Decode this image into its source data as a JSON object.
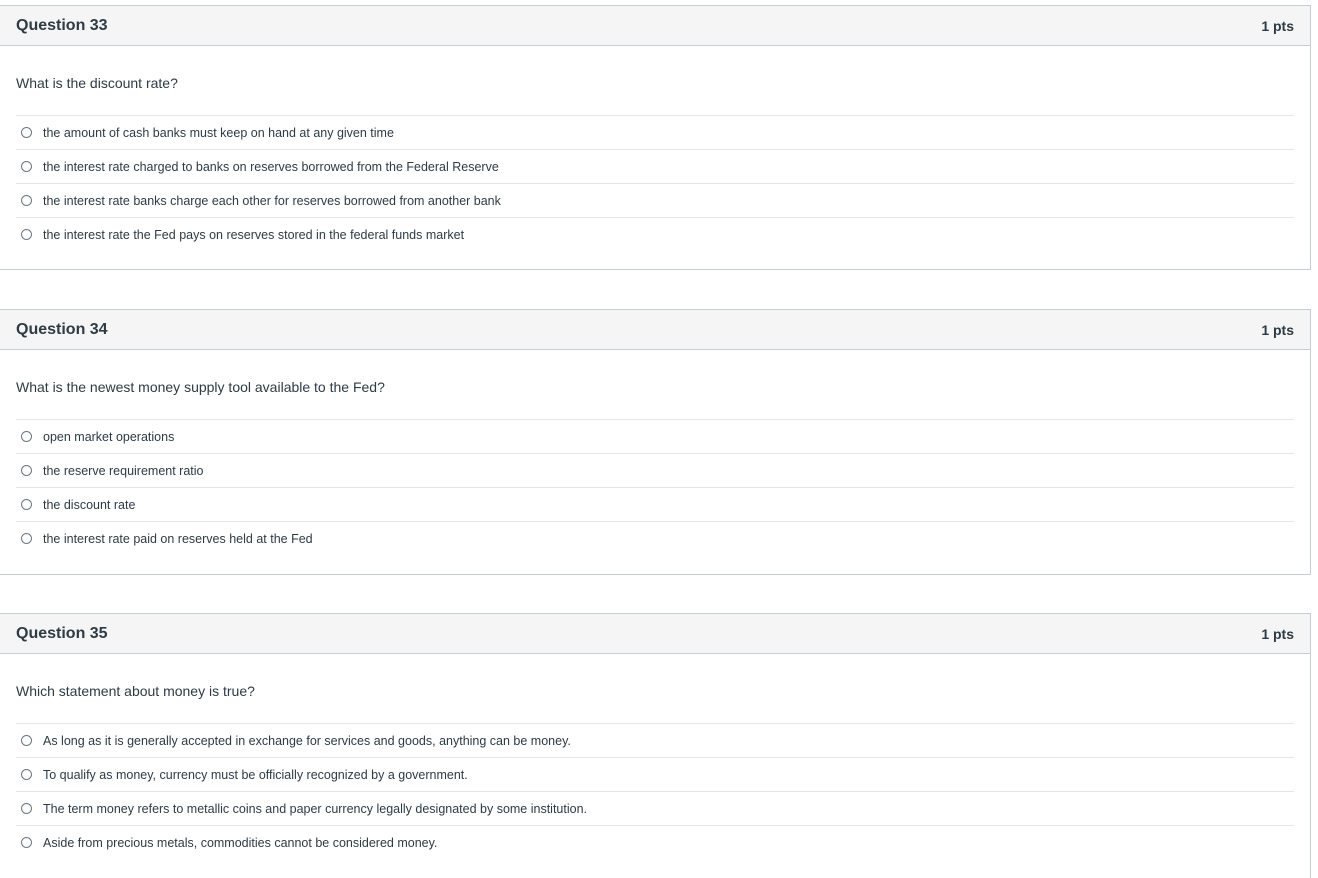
{
  "questions": [
    {
      "title": "Question 33",
      "points": "1 pts",
      "text": "What is the discount rate?",
      "answers": [
        "the amount of cash banks must keep on hand at any given time",
        "the interest rate charged to banks on reserves borrowed from the Federal Reserve",
        "the interest rate banks charge each other for reserves borrowed from another bank",
        "the interest rate the Fed pays on reserves stored in the federal funds market"
      ]
    },
    {
      "title": "Question 34",
      "points": "1 pts",
      "text": "What is the newest money supply tool available to the Fed?",
      "answers": [
        "open market operations",
        "the reserve requirement ratio",
        "the discount rate",
        "the interest rate paid on reserves held at the Fed"
      ]
    },
    {
      "title": "Question 35",
      "points": "1 pts",
      "text": "Which statement about money is true?",
      "answers": [
        "As long as it is generally accepted in exchange for services and goods, anything can be money.",
        "To qualify as money, currency must be officially recognized by a government.",
        "The term money refers to metallic coins and paper currency legally designated by some institution.",
        "Aside from precious metals, commodities cannot be considered money."
      ]
    }
  ]
}
